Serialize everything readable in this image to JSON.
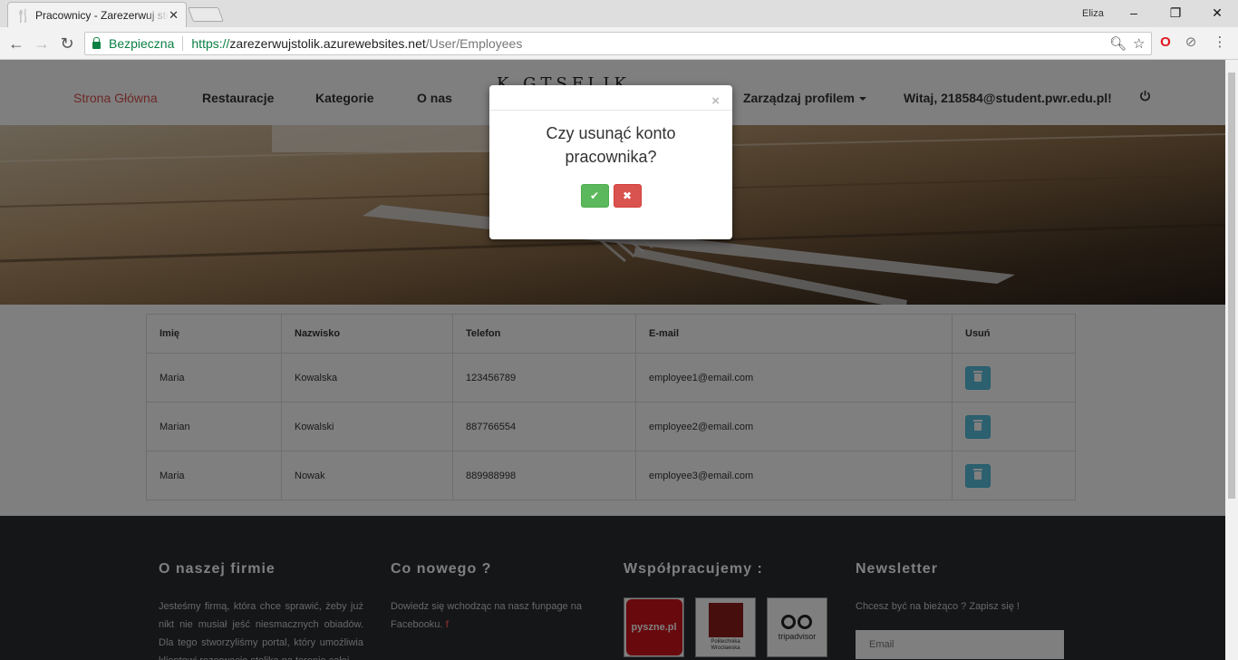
{
  "browser": {
    "tab_title": "Pracownicy - Zarezerwuj stolik",
    "profile_name": "Eliza",
    "secure_label": "Bezpieczna",
    "url_scheme": "https://",
    "url_host": "zarezerwujstolik.azurewebsites.net",
    "url_path": "/User/Employees"
  },
  "nav": {
    "home": "Strona Główna",
    "restaurants": "Restauracje",
    "categories": "Kategorie",
    "about": "O nas",
    "logo": "K  GTSFLIK",
    "manage_profile": "Zarządzaj profilem",
    "greeting": "Witaj, 218584@student.pwr.edu.pl!"
  },
  "table": {
    "headers": [
      "Imię",
      "Nazwisko",
      "Telefon",
      "E-mail",
      "Usuń"
    ],
    "rows": [
      {
        "first": "Maria",
        "last": "Kowalska",
        "phone": "123456789",
        "email": "employee1@email.com"
      },
      {
        "first": "Marian",
        "last": "Kowalski",
        "phone": "887766554",
        "email": "employee2@email.com"
      },
      {
        "first": "Maria",
        "last": "Nowak",
        "phone": "889988998",
        "email": "employee3@email.com"
      }
    ]
  },
  "footer": {
    "about_title": "O naszej firmie",
    "about_text": "Jesteśmy firmą, która chce sprawić, żeby już nikt nie musiał jeść niesmacznych obiadów. Dla tego stworzyliśmy portal, który umożliwia klientowi rezerwację stolika na terenie całej",
    "news_title": "Co nowego ?",
    "news_text": "Dowiedz się wchodząc na nasz funpage na Facebooku.",
    "fb_icon": "f",
    "partners_title": "Współpracujemy :",
    "partner_pyszne": "pyszne.pl",
    "partner_pwr": "Politechnika Wrocławska",
    "partner_trip": "tripadvisor",
    "newsletter_title": "Newsletter",
    "newsletter_text": "Chcesz być na bieżąco ? Zapisz się !",
    "newsletter_placeholder": "Email"
  },
  "modal": {
    "close_symbol": "×",
    "message": "Czy usunąć konto pracownika?",
    "confirm_icon": "✔",
    "cancel_icon": "✖"
  }
}
